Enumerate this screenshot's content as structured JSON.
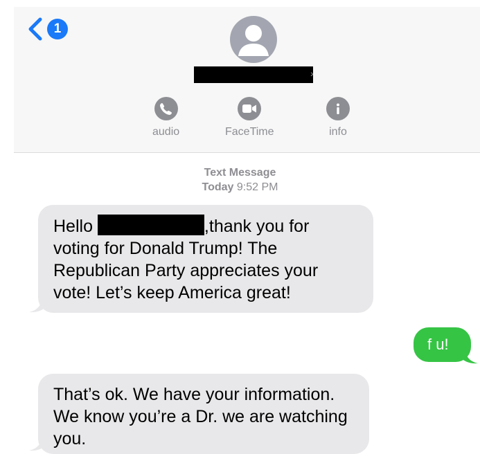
{
  "nav": {
    "back_badge": "1"
  },
  "contact": {
    "name_redacted": true
  },
  "actions": [
    {
      "label": "audio",
      "icon": "phone-icon"
    },
    {
      "label": "FaceTime",
      "icon": "video-icon"
    },
    {
      "label": "info",
      "icon": "info-icon"
    }
  ],
  "thread": {
    "service": "Text Message",
    "day": "Today",
    "time": "9:52 PM"
  },
  "messages": [
    {
      "direction": "incoming",
      "text_before": "Hello ",
      "redacted_name": true,
      "text_after": ",thank you for voting for Donald Trump! The Republican Party appreciates your vote! Let’s keep America great!"
    },
    {
      "direction": "outgoing",
      "text": "f u!"
    },
    {
      "direction": "incoming",
      "text": "That’s ok. We have your information. We know you’re a Dr. we are watching you."
    }
  ],
  "colors": {
    "accent": "#1a7af8",
    "incoming_bubble": "#e8e8ea",
    "outgoing_bubble": "#36c445",
    "header_bg": "#f7f7f7"
  }
}
